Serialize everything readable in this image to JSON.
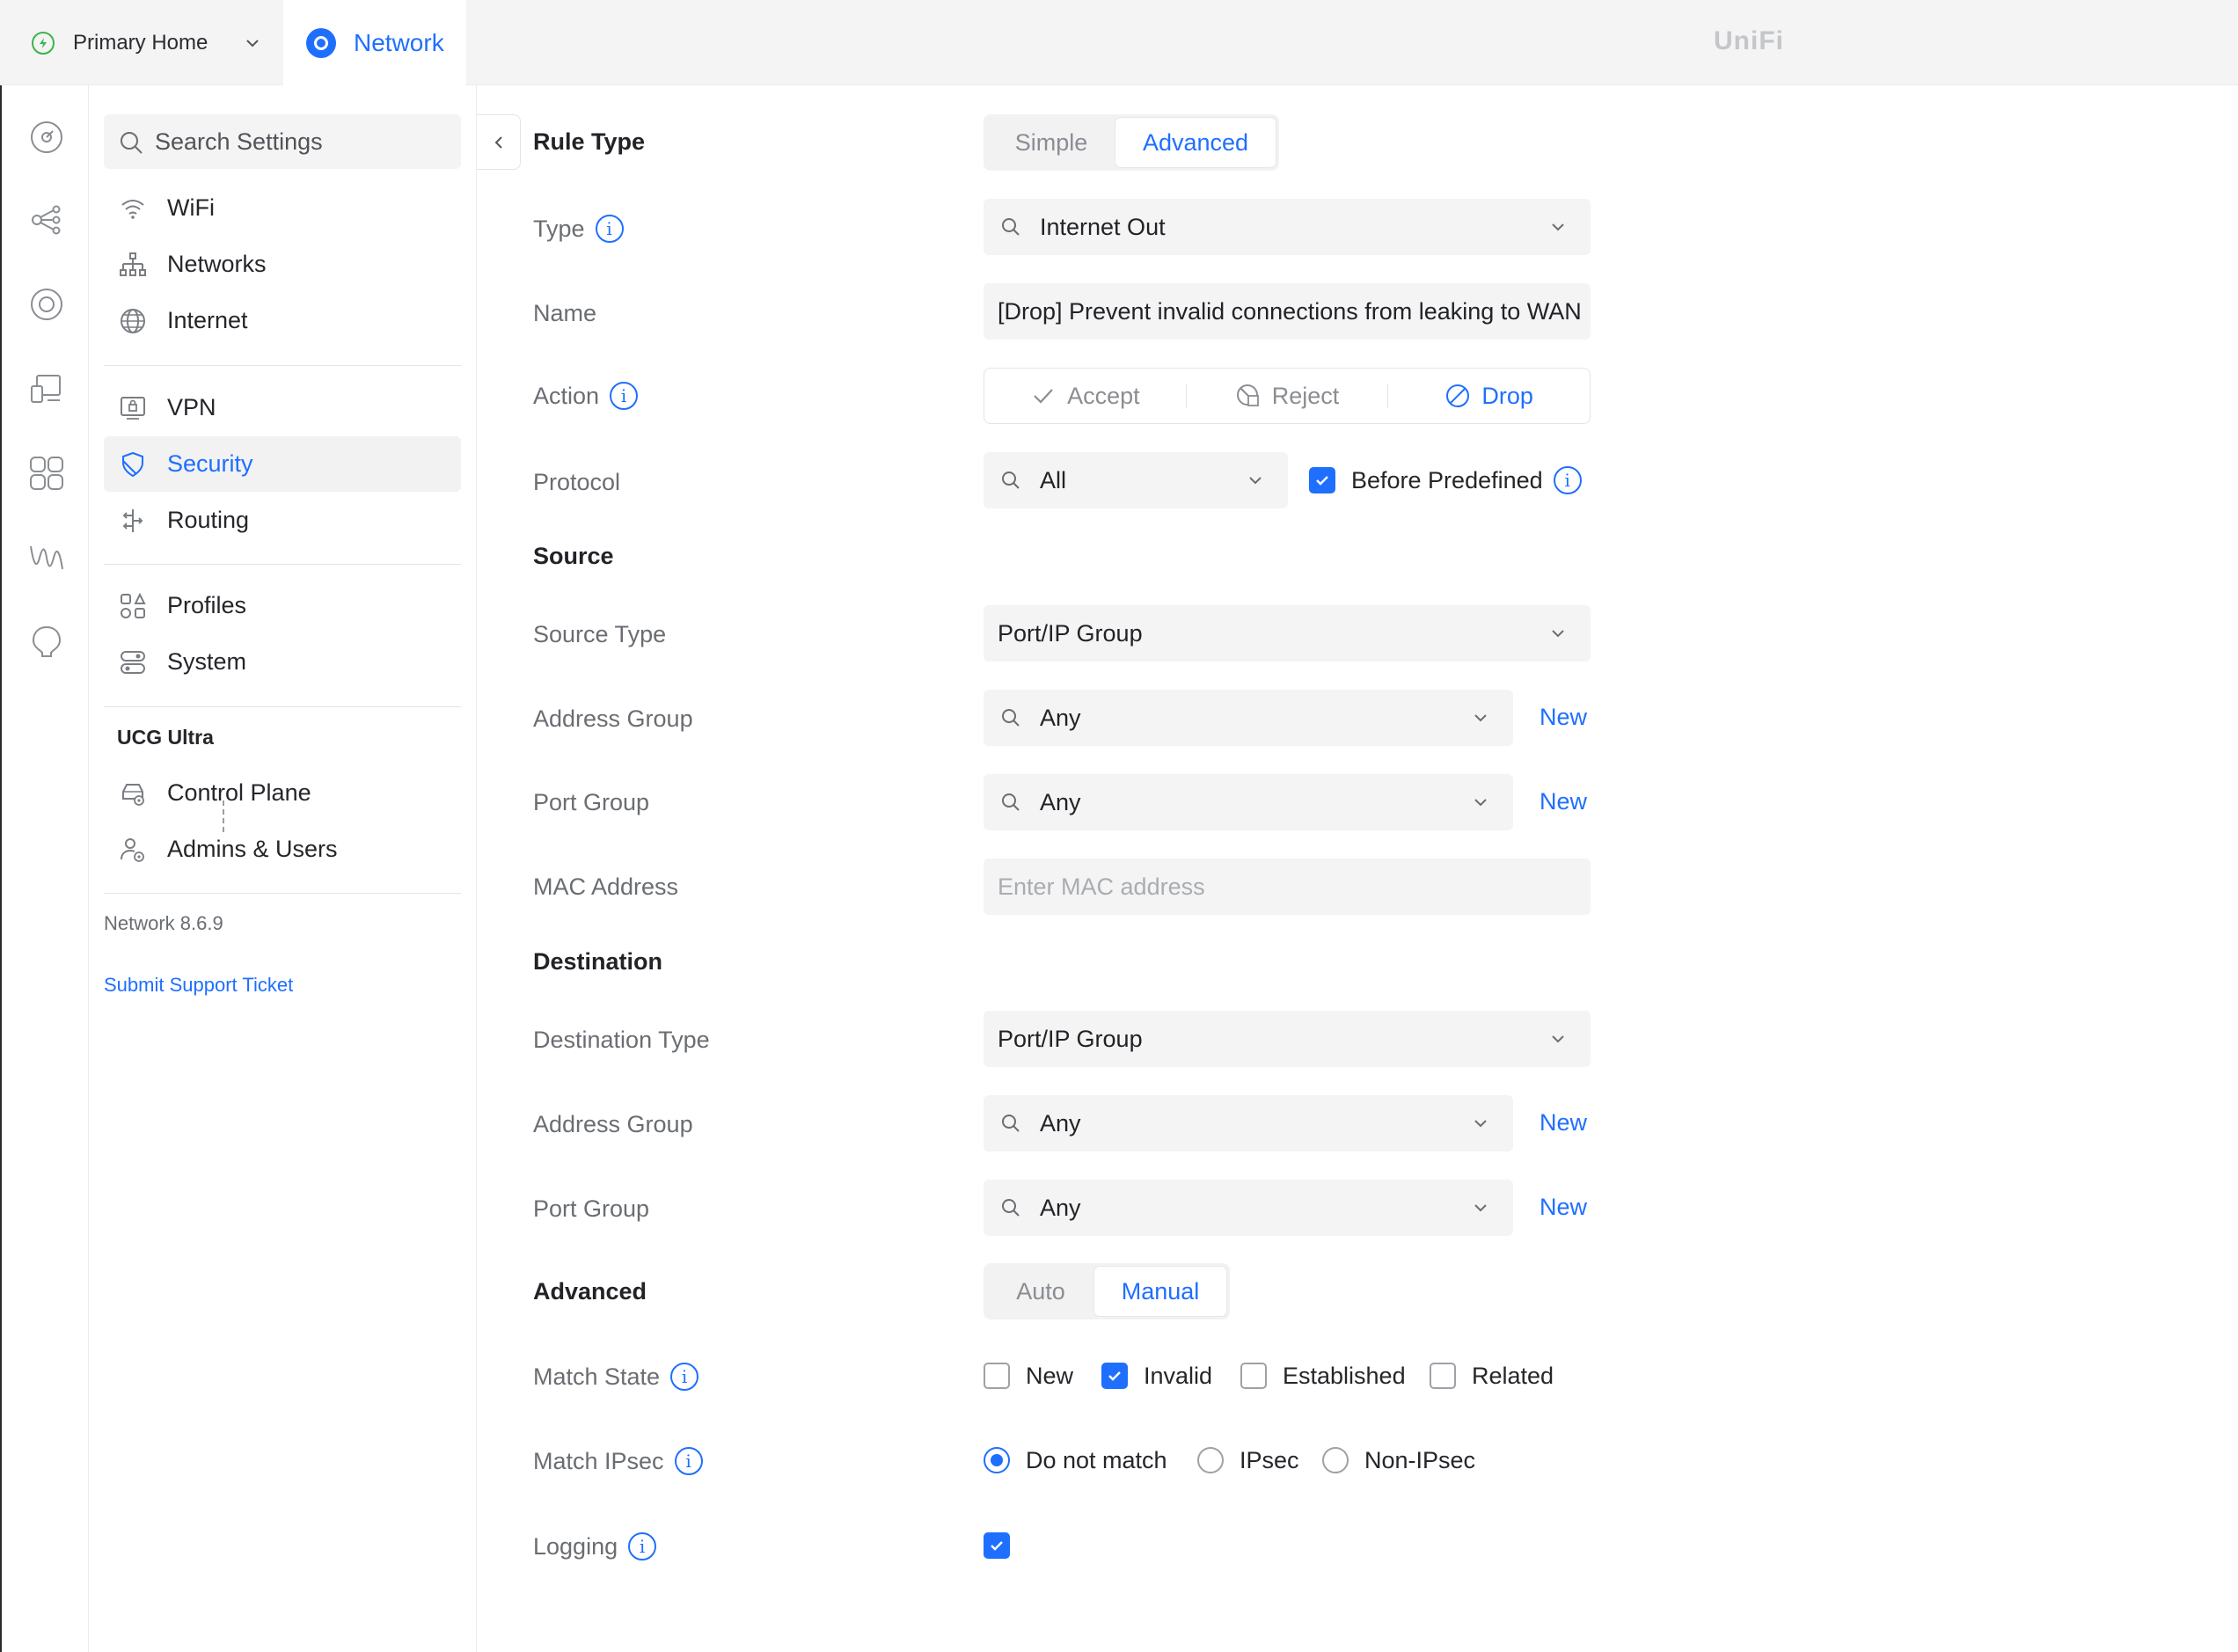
{
  "topbar": {
    "site_name": "Primary Home",
    "app_tab": "Network",
    "brand": "UniFi"
  },
  "rail": {
    "icons": [
      "dashboard-icon",
      "topology-icon",
      "devices-icon",
      "clients-icon",
      "apps-icon",
      "insights-icon",
      "alerts-icon"
    ]
  },
  "nav": {
    "search_placeholder": "Search Settings",
    "items": [
      {
        "label": "WiFi",
        "icon": "wifi-icon"
      },
      {
        "label": "Networks",
        "icon": "networks-icon"
      },
      {
        "label": "Internet",
        "icon": "globe-icon"
      },
      {
        "label": "VPN",
        "icon": "vpn-icon"
      },
      {
        "label": "Security",
        "icon": "shield-icon",
        "active": true
      },
      {
        "label": "Routing",
        "icon": "routing-icon"
      },
      {
        "label": "Profiles",
        "icon": "profiles-icon"
      },
      {
        "label": "System",
        "icon": "system-icon"
      }
    ],
    "device_group": "UCG Ultra",
    "device_items": [
      {
        "label": "Control Plane",
        "icon": "control-plane-icon"
      },
      {
        "label": "Admins & Users",
        "icon": "admins-icon"
      }
    ],
    "version": "Network 8.6.9",
    "support_link": "Submit Support Ticket"
  },
  "form": {
    "rule_type": {
      "label": "Rule Type",
      "options": [
        "Simple",
        "Advanced"
      ],
      "selected": "Advanced"
    },
    "type": {
      "label": "Type",
      "value": "Internet Out"
    },
    "name": {
      "label": "Name",
      "value": "[Drop] Prevent invalid connections from leaking to WAN"
    },
    "action": {
      "label": "Action",
      "options": [
        "Accept",
        "Reject",
        "Drop"
      ],
      "selected": "Drop"
    },
    "protocol": {
      "label": "Protocol",
      "value": "All",
      "before_predefined_label": "Before Predefined",
      "before_predefined": true
    },
    "source": {
      "heading": "Source",
      "type_label": "Source Type",
      "type_value": "Port/IP Group",
      "address_label": "Address Group",
      "address_value": "Any",
      "port_label": "Port Group",
      "port_value": "Any",
      "mac_label": "MAC Address",
      "mac_placeholder": "Enter MAC address",
      "new_label": "New"
    },
    "destination": {
      "heading": "Destination",
      "type_label": "Destination Type",
      "type_value": "Port/IP Group",
      "address_label": "Address Group",
      "address_value": "Any",
      "port_label": "Port Group",
      "port_value": "Any",
      "new_label": "New"
    },
    "advanced": {
      "label": "Advanced",
      "options": [
        "Auto",
        "Manual"
      ],
      "selected": "Manual"
    },
    "match_state": {
      "label": "Match State",
      "options": [
        {
          "label": "New",
          "checked": false
        },
        {
          "label": "Invalid",
          "checked": true
        },
        {
          "label": "Established",
          "checked": false
        },
        {
          "label": "Related",
          "checked": false
        }
      ]
    },
    "match_ipsec": {
      "label": "Match IPsec",
      "options": [
        {
          "label": "Do not match",
          "selected": true
        },
        {
          "label": "IPsec",
          "selected": false
        },
        {
          "label": "Non-IPsec",
          "selected": false
        }
      ]
    },
    "logging": {
      "label": "Logging",
      "checked": true
    }
  },
  "colors": {
    "accent": "#1f6fff",
    "status_ok": "#39b54a"
  }
}
